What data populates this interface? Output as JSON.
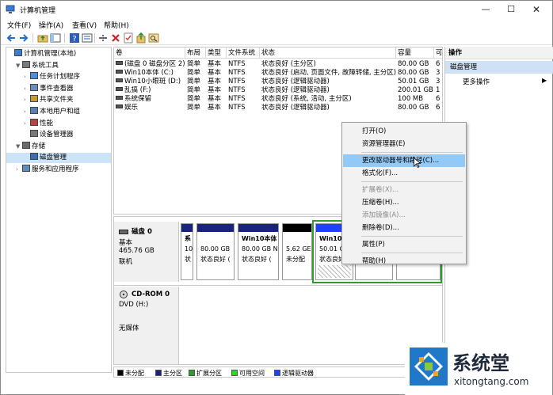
{
  "window": {
    "title": "计算机管理"
  },
  "menubar": [
    "文件(F)",
    "操作(A)",
    "查看(V)",
    "帮助(H)"
  ],
  "toolbar_icons": [
    "back-icon",
    "forward-icon",
    "up-folder-icon",
    "show-hide-tree-icon",
    "help-icon",
    "properties-icon",
    "connect-icon",
    "delete-icon",
    "check-icon",
    "export-icon",
    "search-icon"
  ],
  "tree": [
    {
      "label": "计算机管理(本地)",
      "level": 0,
      "arrow": ""
    },
    {
      "label": "系统工具",
      "level": 1,
      "arrow": "▼"
    },
    {
      "label": "任务计划程序",
      "level": 2,
      "arrow": "›"
    },
    {
      "label": "事件查看器",
      "level": 2,
      "arrow": "›"
    },
    {
      "label": "共享文件夹",
      "level": 2,
      "arrow": "›"
    },
    {
      "label": "本地用户和组",
      "level": 2,
      "arrow": "›"
    },
    {
      "label": "性能",
      "level": 2,
      "arrow": "›"
    },
    {
      "label": "设备管理器",
      "level": 2,
      "arrow": ""
    },
    {
      "label": "存储",
      "level": 1,
      "arrow": "▼"
    },
    {
      "label": "磁盘管理",
      "level": 2,
      "arrow": "",
      "selected": true
    },
    {
      "label": "服务和应用程序",
      "level": 1,
      "arrow": "›"
    }
  ],
  "volumes": {
    "headers": [
      "卷",
      "布局",
      "类型",
      "文件系统",
      "状态",
      "容量",
      "可"
    ],
    "rows": [
      [
        "(磁盘 0 磁盘分区 2)",
        "简单",
        "基本",
        "NTFS",
        "状态良好 (主分区)",
        "80.00 GB",
        "6"
      ],
      [
        "Win10本体 (C:)",
        "简单",
        "基本",
        "NTFS",
        "状态良好 (启动, 页面文件, 故障转储, 主分区)",
        "80.00 GB",
        "3"
      ],
      [
        "Win10小眼斑 (D:)",
        "简单",
        "基本",
        "NTFS",
        "状态良好 (逻辑驱动器)",
        "50.01 GB",
        "3"
      ],
      [
        "乱搞 (F:)",
        "简单",
        "基本",
        "NTFS",
        "状态良好 (逻辑驱动器)",
        "200.01 GB",
        "1"
      ],
      [
        "系统保留",
        "简单",
        "基本",
        "NTFS",
        "状态良好 (系统, 活动, 主分区)",
        "100 MB",
        "6"
      ],
      [
        "娱乐",
        "简单",
        "基本",
        "NTFS",
        "状态良好 (逻辑驱动器)",
        "80.00 GB",
        "6"
      ]
    ]
  },
  "disks": [
    {
      "name": "磁盘 0",
      "lines": [
        "基本",
        "465.76 GB",
        "联机"
      ],
      "partitions": [
        {
          "title": "系",
          "size": "10",
          "status": "状"
        },
        {
          "title": "",
          "size": "80.00 GB",
          "status": "状态良好 ("
        },
        {
          "title": "Win10本体",
          "size": "80.00 GB N",
          "status": "状态良好 ("
        },
        {
          "title": "",
          "size": "5.62 GE",
          "status": "未分配"
        },
        {
          "title": "Win10小",
          "size": "50.01 G",
          "status": "状态良好"
        },
        {
          "title": "",
          "size": "",
          "status": ""
        },
        {
          "title": "",
          "size": "",
          "status": ""
        }
      ]
    },
    {
      "name": "CD-ROM 0",
      "lines": [
        "DVD (H:)",
        "",
        "无媒体"
      ]
    }
  ],
  "legend": [
    {
      "label": "未分配",
      "color": "#000000"
    },
    {
      "label": "主分区",
      "color": "#1a237e"
    },
    {
      "label": "扩展分区",
      "color": "#2e9c2e"
    },
    {
      "label": "可用空间",
      "color": "#22dd22"
    },
    {
      "label": "逻辑驱动器",
      "color": "#1e40ff"
    }
  ],
  "actions": {
    "header": "操作",
    "section": "磁盘管理",
    "more": "更多操作"
  },
  "context_menu": [
    {
      "label": "打开(O)",
      "state": "normal"
    },
    {
      "label": "资源管理器(E)",
      "state": "normal"
    },
    {
      "sep": true
    },
    {
      "label": "更改驱动器号和路径(C)...",
      "state": "highlight"
    },
    {
      "label": "格式化(F)...",
      "state": "normal"
    },
    {
      "sep": true
    },
    {
      "label": "扩展卷(X)...",
      "state": "disabled"
    },
    {
      "label": "压缩卷(H)...",
      "state": "normal"
    },
    {
      "label": "添加镜像(A)...",
      "state": "disabled"
    },
    {
      "label": "删除卷(D)...",
      "state": "normal"
    },
    {
      "sep": true
    },
    {
      "label": "属性(P)",
      "state": "normal"
    },
    {
      "sep": true
    },
    {
      "label": "帮助(H)",
      "state": "normal"
    }
  ],
  "watermark": {
    "brand": "系统堂",
    "url": "xitongtang.com"
  }
}
